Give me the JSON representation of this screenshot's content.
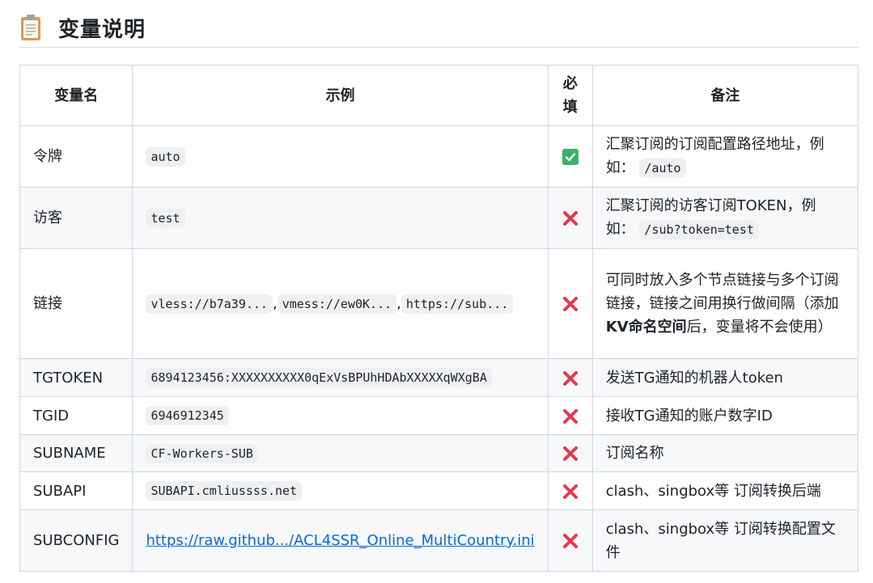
{
  "section": {
    "icon": "clipboard-icon",
    "title": "变量说明"
  },
  "table": {
    "headers": {
      "name": "变量名",
      "example": "示例",
      "required": "必填",
      "note": "备注"
    },
    "rows": [
      {
        "name": "令牌",
        "examples": [
          "auto"
        ],
        "required": true,
        "note_parts": [
          "汇聚订阅的订阅配置路径地址，例如：",
          "/auto"
        ]
      },
      {
        "name": "访客",
        "examples": [
          "test"
        ],
        "required": false,
        "note_parts": [
          "汇聚订阅的访客订阅TOKEN，例如：",
          "/sub?token=test"
        ]
      },
      {
        "name": "链接",
        "examples": [
          "vless://b7a39...",
          "vmess://ew0K...",
          "https://sub..."
        ],
        "separator": ",",
        "required": false,
        "note_parts": [
          "可同时放入多个节点链接与多个订阅链接，链接之间用换行做间隔（添加",
          "KV命名空间",
          "后，变量将不会使用）"
        ]
      },
      {
        "name": "TGTOKEN",
        "examples": [
          "6894123456:XXXXXXXXXX0qExVsBPUhHDAbXXXXXqWXgBA"
        ],
        "required": false,
        "note": "发送TG通知的机器人token"
      },
      {
        "name": "TGID",
        "examples": [
          "6946912345"
        ],
        "required": false,
        "note": "接收TG通知的账户数字ID"
      },
      {
        "name": "SUBNAME",
        "examples": [
          "CF-Workers-SUB"
        ],
        "required": false,
        "note": "订阅名称"
      },
      {
        "name": "SUBAPI",
        "examples": [
          "SUBAPI.cmliussss.net"
        ],
        "required": false,
        "note": "clash、singbox等 订阅转换后端"
      },
      {
        "name": "SUBCONFIG",
        "link": "https://raw.github.../ACL4SSR_Online_MultiCountry.ini",
        "required": false,
        "note": "clash、singbox等 订阅转换配置文件"
      }
    ]
  },
  "colors": {
    "check": "#3fb068",
    "cross": "#e5394d",
    "link": "#0969da",
    "border": "#d0d7de",
    "stripe": "#f6f8fa"
  }
}
